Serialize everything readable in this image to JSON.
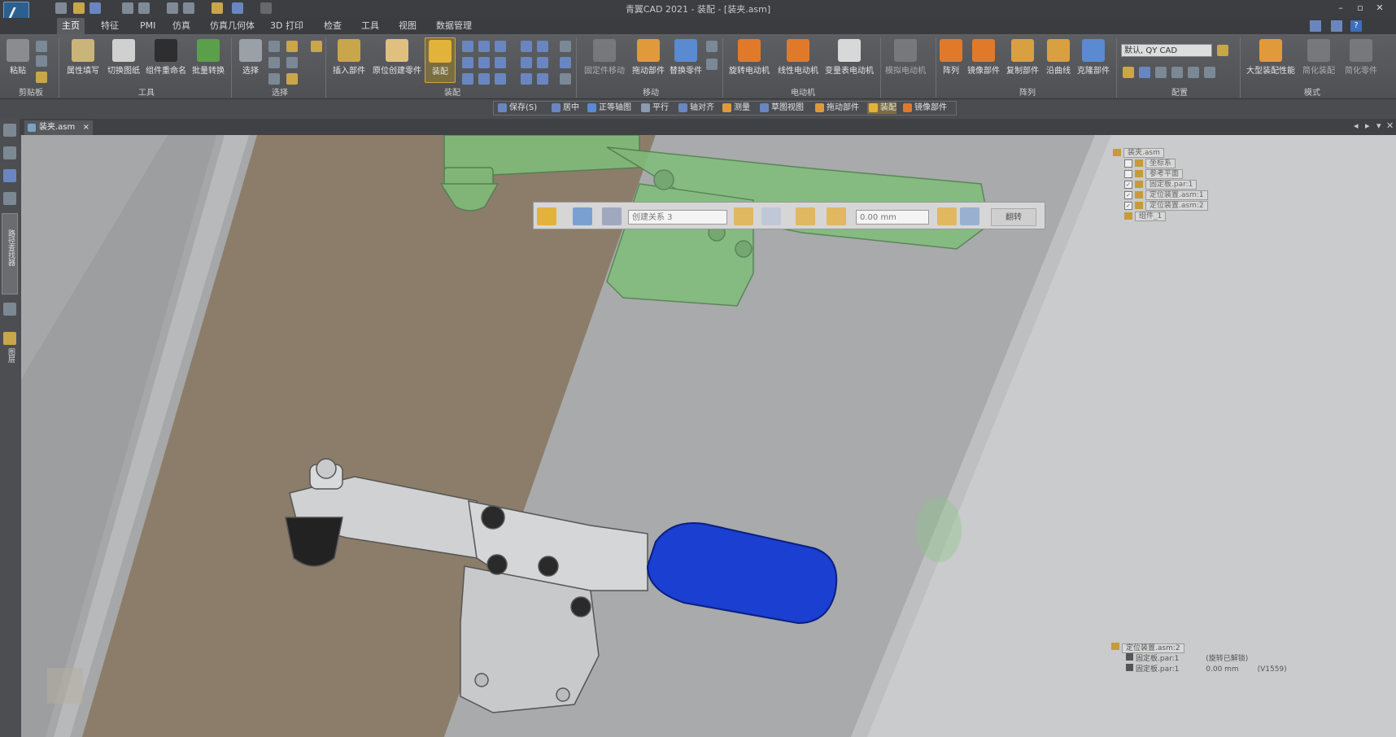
{
  "window": {
    "title": "青翼CAD 2021 - 装配 - [装夹.asm]"
  },
  "quick_access": [
    "new-icon",
    "open-icon",
    "save-icon",
    "print-icon",
    "undo-icon",
    "redo-icon"
  ],
  "menu_tabs": [
    "主页",
    "特征",
    "PMI",
    "仿真",
    "仿真几何体",
    "3D 打印",
    "检查",
    "工具",
    "视图",
    "数据管理"
  ],
  "ribbon": {
    "groups": [
      "剪贴板",
      "工具",
      "选择",
      "装配",
      "移动",
      "电动机",
      "阵列",
      "配置",
      "模式"
    ],
    "buttons": {
      "paste": "粘贴",
      "attr_fill": "属性填写",
      "switch_drawing": "切换图纸",
      "rename": "组件重命名",
      "batch": "批量转换",
      "select": "选择",
      "insert_part": "插入部件",
      "inplace_create": "原位创建零件",
      "assemble": "装配",
      "fix_move": "固定件移动",
      "drag_part": "拖动部件",
      "replace_part": "替换零件",
      "rot_motor": "旋转电动机",
      "lin_motor": "线性电动机",
      "var_motor": "变量表电动机",
      "sim_motor": "模拟电动机",
      "array": "阵列",
      "mirror": "镜像部件",
      "copy": "复制部件",
      "along_curve": "沿曲线",
      "clone": "克隆部件",
      "large_perf": "大型装配性能",
      "simplify1": "简化装配",
      "simplify2": "简化零件"
    },
    "config_combo": "默认, QY CAD"
  },
  "sub_toolbar": [
    "保存(S)",
    "居中",
    "正等轴图",
    "平行",
    "轴对齐",
    "测量",
    "草图视图",
    "拖动部件",
    "装配",
    "镜像部件"
  ],
  "doc_tab": {
    "label": "装夹.asm",
    "close": "×"
  },
  "left_panel": {
    "vtext1": "路径查找器",
    "vtext2": "图层"
  },
  "float_toolbar": {
    "relation_combo": "创建关系 3",
    "offset_value": "0.00 mm",
    "flip_label": "翻转"
  },
  "tree": {
    "root": "装夹.asm",
    "items": [
      "坐标系",
      "参考平面",
      "固定板.par:1",
      "定位装置.asm:1",
      "定位装置.asm:2",
      "组件_1"
    ]
  },
  "relations": {
    "header": "定位装置.asm:2",
    "rows": [
      {
        "part": "固定板.par:1",
        "info": "(旋转已解锁)"
      },
      {
        "part": "固定板.par:1",
        "info": "0.00 mm",
        "extra": "(V1559)"
      }
    ]
  },
  "colors": {
    "handle_blue": "#1a3fd1",
    "assembled_green": "#7fbf7a",
    "base_plate": "#8c7d6a"
  }
}
